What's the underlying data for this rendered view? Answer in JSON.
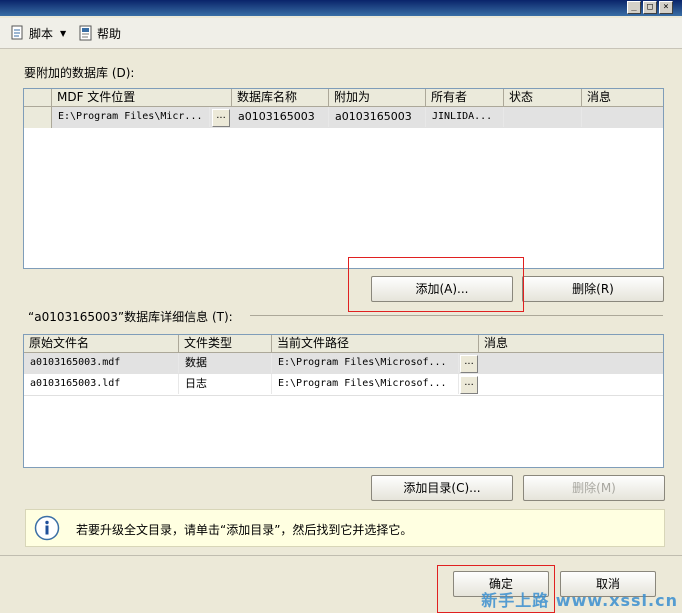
{
  "toolbar": {
    "script_label": "脚本",
    "help_label": "帮助"
  },
  "attach": {
    "label": "要附加的数据库 (D):",
    "columns": [
      "MDF 文件位置",
      "数据库名称",
      "附加为",
      "所有者",
      "状态",
      "消息"
    ],
    "row": {
      "mdf": "E:\\Program Files\\Micr...",
      "db_name": "a0103165003",
      "attach_as": "a0103165003",
      "owner": "JINLIDA...",
      "status": "",
      "message": ""
    },
    "add_button": "添加(A)...",
    "remove_button": "删除(R)"
  },
  "details": {
    "label": "“a0103165003”数据库详细信息 (T):",
    "columns": [
      "原始文件名",
      "文件类型",
      "当前文件路径",
      "消息"
    ],
    "rows": [
      {
        "name": "a0103165003.mdf",
        "type": "数据",
        "path": "E:\\Program Files\\Microsof...",
        "message": ""
      },
      {
        "name": "a0103165003.ldf",
        "type": "日志",
        "path": "E:\\Program Files\\Microsof...",
        "message": ""
      }
    ],
    "add_catalog_button": "添加目录(C)...",
    "remove_button": "删除(M)"
  },
  "info": {
    "text": "若要升级全文目录，请单击“添加目录”，然后找到它并选择它。"
  },
  "footer": {
    "ok_button": "确定",
    "cancel_button": "取消"
  },
  "watermark": "新手上路 www.xssl.cn",
  "colors": {
    "highlight_box": "#e02020",
    "info_bg": "#ffffe1",
    "title_bar": "#0a246a"
  }
}
